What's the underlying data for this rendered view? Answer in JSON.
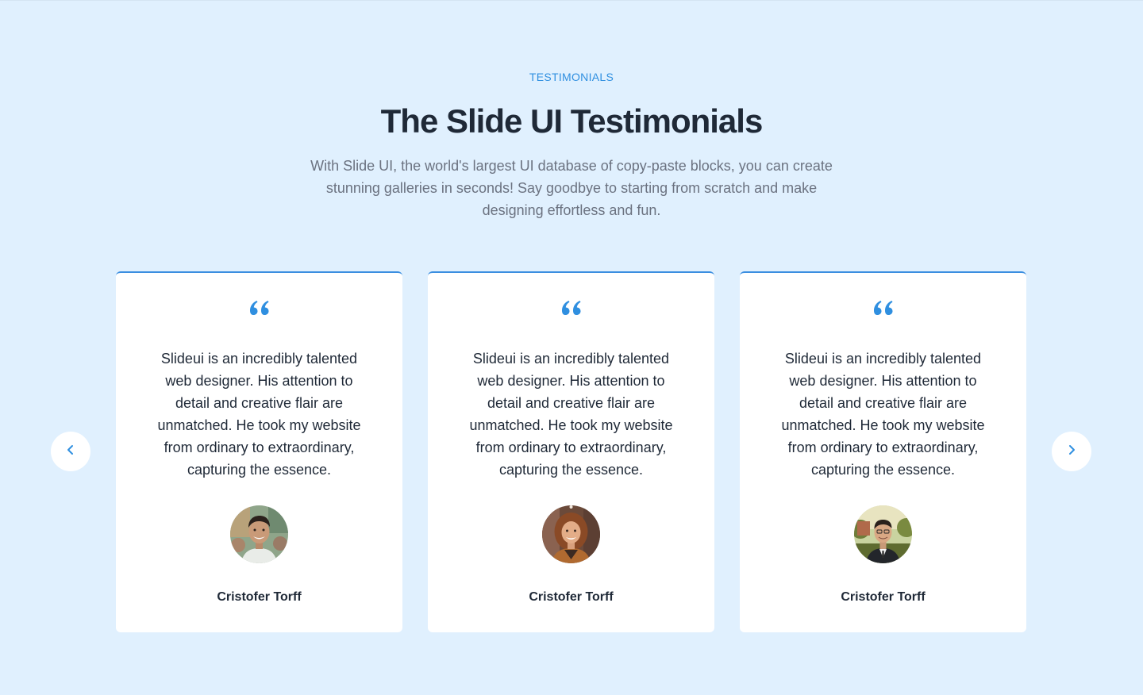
{
  "section": {
    "eyebrow": "TESTIMONIALS",
    "title": "The Slide UI Testimonials",
    "subtitle": "With Slide UI, the world's largest UI database of copy-paste blocks, you can create stunning galleries in seconds! Say goodbye to starting from scratch and make designing effortless and fun."
  },
  "colors": {
    "background": "#e0f0fe",
    "accent": "#2f8fe0",
    "heading": "#1f2937",
    "muted": "#6b7280",
    "card": "#ffffff"
  },
  "navigation": {
    "prev_icon": "chevron-left-icon",
    "next_icon": "chevron-right-icon"
  },
  "testimonials": [
    {
      "quote_icon": "quote-icon",
      "text": "Slideui is an incredibly talented web designer. His attention to detail and creative flair are unmatched. He took my website from ordinary to extraordinary, capturing the essence.",
      "author": "Cristofer Torff",
      "avatar": "avatar-photo-man-smiling"
    },
    {
      "quote_icon": "quote-icon",
      "text": "Slideui is an incredibly talented web designer. His attention to detail and creative flair are unmatched. He took my website from ordinary to extraordinary, capturing the essence.",
      "author": "Cristofer Torff",
      "avatar": "avatar-photo-woman-curly-hair"
    },
    {
      "quote_icon": "quote-icon",
      "text": "Slideui is an incredibly talented web designer. His attention to detail and creative flair are unmatched. He took my website from ordinary to extraordinary, capturing the essence.",
      "author": "Cristofer Torff",
      "avatar": "avatar-photo-man-suit"
    }
  ]
}
